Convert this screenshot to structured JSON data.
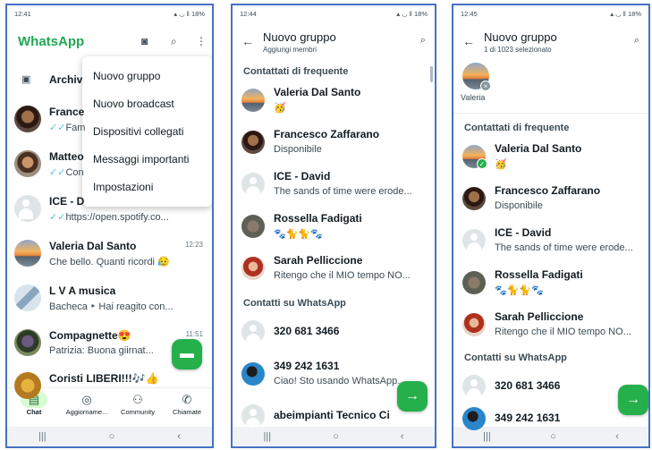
{
  "colors": {
    "whatsapp_green": "#25b04b",
    "title_green": "#1fa855",
    "panel_border": "#4472c4",
    "read_tick": "#53bdeb"
  },
  "panel1": {
    "status_time": "12:41",
    "status_right": "18%",
    "app_title": "WhatsApp",
    "menu": [
      "Nuovo gruppo",
      "Nuovo broadcast",
      "Dispositivi collegati",
      "Messaggi importanti",
      "Impostazioni"
    ],
    "archived_label": "Archivi",
    "chats": [
      {
        "name": "France",
        "msg": "Fam",
        "tick": "✓✓",
        "avatar": "man"
      },
      {
        "name": "Matteo",
        "msg": "Con",
        "tick": "✓✓",
        "avatar": "beard"
      },
      {
        "name": "ICE - D",
        "msg": "https://open.spotify.co...",
        "tick": "✓✓",
        "avatar": "blank"
      },
      {
        "name": "Valeria Dal Santo",
        "msg": "Che bello.  Quanti ricordi 😥",
        "time": "12:23",
        "avatar": "sunset"
      },
      {
        "name": "L V A musica",
        "msg": "Bacheca ‣ Hai reagito con...",
        "avatar": "tri"
      },
      {
        "name": "Compagnette😍",
        "msg": "Patrizia: Buona giirnat...",
        "time": "11:51",
        "avatar": "photo"
      },
      {
        "name": "Coristi LIBERI!!!🎶👍",
        "msg": "",
        "avatar": "gold"
      }
    ],
    "tabs": [
      "Chat",
      "Aggiorname...",
      "Community",
      "Chiamate"
    ],
    "nav": [
      "|||",
      "○",
      "‹"
    ]
  },
  "panel2": {
    "status_time": "12:44",
    "status_right": "18%",
    "title": "Nuovo gruppo",
    "subtitle": "Aggiungi membri",
    "section_frequent": "Contattati di frequente",
    "frequent": [
      {
        "name": "Valeria Dal Santo",
        "status": "🥳",
        "avatar": "sunset"
      },
      {
        "name": "Francesco Zaffarano",
        "status": "Disponibile",
        "avatar": "man"
      },
      {
        "name": "ICE - David",
        "status": "The sands of time were erode...",
        "avatar": "blank"
      },
      {
        "name": "Rossella Fadigati",
        "status": "🐾🐈🐈🐾",
        "avatar": "grey"
      },
      {
        "name": "Sarah Pelliccione",
        "status": "Ritengo che il MIO tempo NO...",
        "avatar": "girl"
      }
    ],
    "section_whatsapp": "Contatti su WhatsApp",
    "whatsapp": [
      {
        "name": "320 681 3466",
        "status": "",
        "avatar": "blank"
      },
      {
        "name": "349 242 1631",
        "status": "Ciao! Sto usando WhatsApp.",
        "avatar": "dolph"
      },
      {
        "name": "abeimpianti Tecnico Ci",
        "status": "",
        "avatar": "blank"
      }
    ],
    "nav": [
      "|||",
      "○",
      "‹"
    ]
  },
  "panel3": {
    "status_time": "12:45",
    "status_right": "18%",
    "title": "Nuovo gruppo",
    "subtitle": "1 di 1023 selezionato",
    "selected_name": "Valeria",
    "section_frequent": "Contattati di frequente",
    "frequent": [
      {
        "name": "Valeria Dal Santo",
        "status": "🥳",
        "avatar": "sunset"
      },
      {
        "name": "Francesco Zaffarano",
        "status": "Disponibile",
        "avatar": "man"
      },
      {
        "name": "ICE - David",
        "status": "The sands of time were erode...",
        "avatar": "blank"
      },
      {
        "name": "Rossella Fadigati",
        "status": "🐾🐈🐈🐾",
        "avatar": "grey"
      },
      {
        "name": "Sarah Pelliccione",
        "status": "Ritengo che il MIO tempo NO...",
        "avatar": "girl"
      }
    ],
    "section_whatsapp": "Contatti su WhatsApp",
    "whatsapp": [
      {
        "name": "320 681 3466",
        "status": "",
        "avatar": "blank"
      },
      {
        "name": "349 242 1631",
        "status": "",
        "avatar": "dolph"
      }
    ],
    "nav": [
      "|||",
      "○",
      "‹"
    ]
  }
}
